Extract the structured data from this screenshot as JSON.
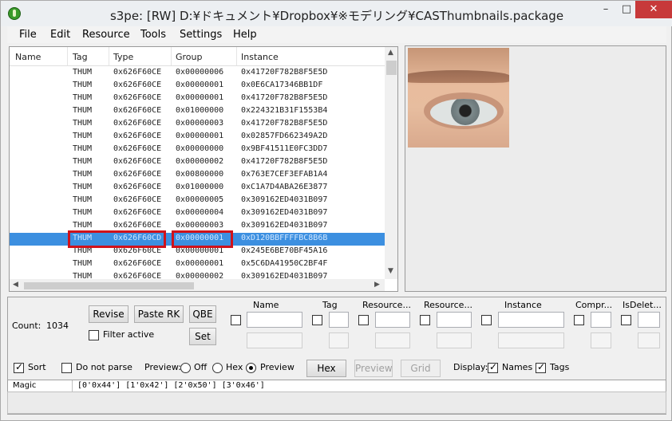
{
  "window": {
    "title": "s3pe: [RW] D:¥ドキュメント¥Dropbox¥※モデリング¥CASThumbnails.package",
    "min_glyph": "–",
    "max_glyph": "□",
    "close_glyph": "✕"
  },
  "menu": [
    "File",
    "Edit",
    "Resource",
    "Tools",
    "Settings",
    "Help"
  ],
  "list": {
    "columns": [
      "Name",
      "Tag",
      "Type",
      "Group",
      "Instance"
    ],
    "rows": [
      {
        "tag": "THUM",
        "type": "0x626F60CE",
        "group": "0x00000006",
        "instance": "0x41720F782B8F5E5D"
      },
      {
        "tag": "THUM",
        "type": "0x626F60CE",
        "group": "0x00000001",
        "instance": "0x0E6CA17346BB1DF"
      },
      {
        "tag": "THUM",
        "type": "0x626F60CE",
        "group": "0x00000001",
        "instance": "0x41720F782B8F5E5D"
      },
      {
        "tag": "THUM",
        "type": "0x626F60CE",
        "group": "0x01000000",
        "instance": "0x224321B31F1553B4"
      },
      {
        "tag": "THUM",
        "type": "0x626F60CE",
        "group": "0x00000003",
        "instance": "0x41720F782B8F5E5D"
      },
      {
        "tag": "THUM",
        "type": "0x626F60CE",
        "group": "0x00000001",
        "instance": "0x02857FD662349A2D"
      },
      {
        "tag": "THUM",
        "type": "0x626F60CE",
        "group": "0x00000000",
        "instance": "0x9BF41511E0FC3DD7"
      },
      {
        "tag": "THUM",
        "type": "0x626F60CE",
        "group": "0x00000002",
        "instance": "0x41720F782B8F5E5D"
      },
      {
        "tag": "THUM",
        "type": "0x626F60CE",
        "group": "0x00800000",
        "instance": "0x763E7CEF3EFAB1A4"
      },
      {
        "tag": "THUM",
        "type": "0x626F60CE",
        "group": "0x01000000",
        "instance": "0xC1A7D4ABA26E3877"
      },
      {
        "tag": "THUM",
        "type": "0x626F60CE",
        "group": "0x00000005",
        "instance": "0x309162ED4031B097"
      },
      {
        "tag": "THUM",
        "type": "0x626F60CE",
        "group": "0x00000004",
        "instance": "0x309162ED4031B097"
      },
      {
        "tag": "THUM",
        "type": "0x626F60CE",
        "group": "0x00000003",
        "instance": "0x309162ED4031B097"
      },
      {
        "tag": "THUM",
        "type": "0x626F60CD",
        "group": "0x00000001",
        "instance": "0xD120BBFFFFBC8B6B",
        "selected": true
      },
      {
        "tag": "THUM",
        "type": "0x626F60CE",
        "group": "0x00000001",
        "instance": "0x245E6BE70BF45A16"
      },
      {
        "tag": "THUM",
        "type": "0x626F60CE",
        "group": "0x00000001",
        "instance": "0x5C6DA41950C2BF4F"
      },
      {
        "tag": "THUM",
        "type": "0x626F60CE",
        "group": "0x00000002",
        "instance": "0x309162ED4031B097"
      }
    ]
  },
  "panel": {
    "count_label": "Count:",
    "count_value": "1034",
    "revise": "Revise",
    "paste_rk": "Paste RK",
    "qbe": "QBE",
    "filter_active": "Filter active",
    "set": "Set",
    "filter_cols": [
      "Name",
      "Tag",
      "Resource...",
      "Resource...",
      "Instance",
      "Compr...",
      "IsDelet..."
    ],
    "sort": "Sort",
    "do_not_parse": "Do not parse",
    "preview_label": "Preview:",
    "off": "Off",
    "hex_radio": "Hex",
    "preview_radio": "Preview",
    "hex_btn": "Hex",
    "preview_btn": "Preview",
    "grid_btn": "Grid",
    "display_label": "Display:",
    "names": "Names",
    "tags": "Tags"
  },
  "magic": {
    "label": "Magic",
    "value": "[0'0x44'] [1'0x42'] [2'0x50'] [3'0x46']"
  }
}
